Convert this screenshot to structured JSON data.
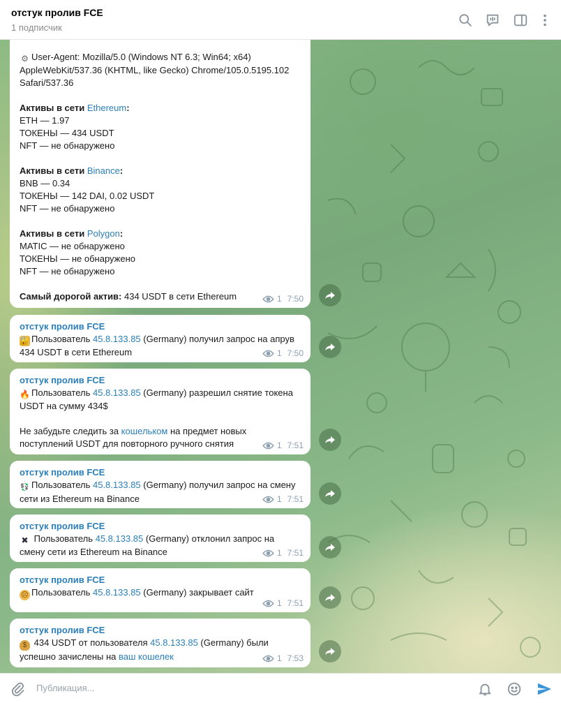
{
  "header": {
    "title": "отстук пролив FCE",
    "subtitle": "1 подписчик"
  },
  "icons": {
    "search": "search-icon",
    "comments": "comments-icon",
    "sidebar": "sidebar-toggle-icon",
    "more": "more-vertical-icon",
    "attach": "paperclip-icon",
    "bell": "bell-icon",
    "emoji": "emoji-icon",
    "send": "send-icon",
    "share": "share-arrow-icon",
    "views": "eye-icon"
  },
  "messages": [
    {
      "lines": {
        "ua1": "User-Agent: Mozilla/5.0 (Windows NT 6.3; Win64; x64)",
        "ua2": "AppleWebKit/537.36 (KHTML, like Gecko) Chrome/105.0.5195.102",
        "ua3": "Safari/537.36",
        "eth_title_pre": "Активы в сети ",
        "eth_title_link": "Ethereum",
        "eth_title_post": ":",
        "eth1": "ETH — 1.97",
        "eth2": "ТОКЕНЫ — 434 USDT",
        "eth3": "NFT — не обнаружено",
        "bnb_title_pre": "Активы в сети ",
        "bnb_title_link": "Binance",
        "bnb_title_post": ":",
        "bnb1": "BNB — 0.34",
        "bnb2": "ТОКЕНЫ — 142 DAI, 0.02 USDT",
        "bnb3": "NFT — не обнаружено",
        "pol_title_pre": "Активы в сети ",
        "pol_title_link": "Polygon",
        "pol_title_post": ":",
        "pol1": "MATIC — не обнаружено",
        "pol2": "ТОКЕНЫ — не обнаружено",
        "pol3": "NFT — не обнаружено",
        "top_label": "Самый дорогой актив:",
        "top_value": " 434 USDT в сети Ethereum"
      },
      "views": "1",
      "time": "7:50"
    },
    {
      "sender": "отстук пролив FCE",
      "pre": "Пользователь ",
      "ip": "45.8.133.85",
      "post": " (Germany) получил запрос на апрув 434 USDT в сети Ethereum",
      "views": "1",
      "time": "7:50"
    },
    {
      "sender": "отстук пролив FCE",
      "pre": "Пользователь ",
      "ip": "45.8.133.85",
      "post": " (Germany) разрешил снятие токена USDT на сумму 434$",
      "p2_pre": "Не забудьте следить за ",
      "p2_link": "кошельком",
      "p2_post": " на предмет новых поступлений USDT для повторного ручного снятия",
      "views": "1",
      "time": "7:51"
    },
    {
      "sender": "отстук пролив FCE",
      "pre": "Пользователь ",
      "ip": "45.8.133.85",
      "post": " (Germany) получил запрос на смену сети из Ethereum на Binance",
      "views": "1",
      "time": "7:51"
    },
    {
      "sender": "отстук пролив FCE",
      "pre": " Пользователь ",
      "ip": "45.8.133.85",
      "post": " (Germany) отклонил запрос на смену сети из Ethereum на Binance",
      "views": "1",
      "time": "7:51"
    },
    {
      "sender": "отстук пролив FCE",
      "pre": "Пользователь ",
      "ip": "45.8.133.85",
      "post": " (Germany)  закрывает сайт",
      "views": "1",
      "time": "7:51"
    },
    {
      "sender": "отстук пролив FCE",
      "pre": " 434 USDT от пользователя ",
      "ip": "45.8.133.85",
      "post": " (Germany) были успешно зачислены на ",
      "link2": "ваш кошелек",
      "views": "1",
      "time": "7:53"
    }
  ],
  "composer": {
    "placeholder": "Публикация..."
  },
  "colors": {
    "link": "#2b7fb8",
    "header_bg": "#ffffff",
    "send": "#3a95d8"
  }
}
